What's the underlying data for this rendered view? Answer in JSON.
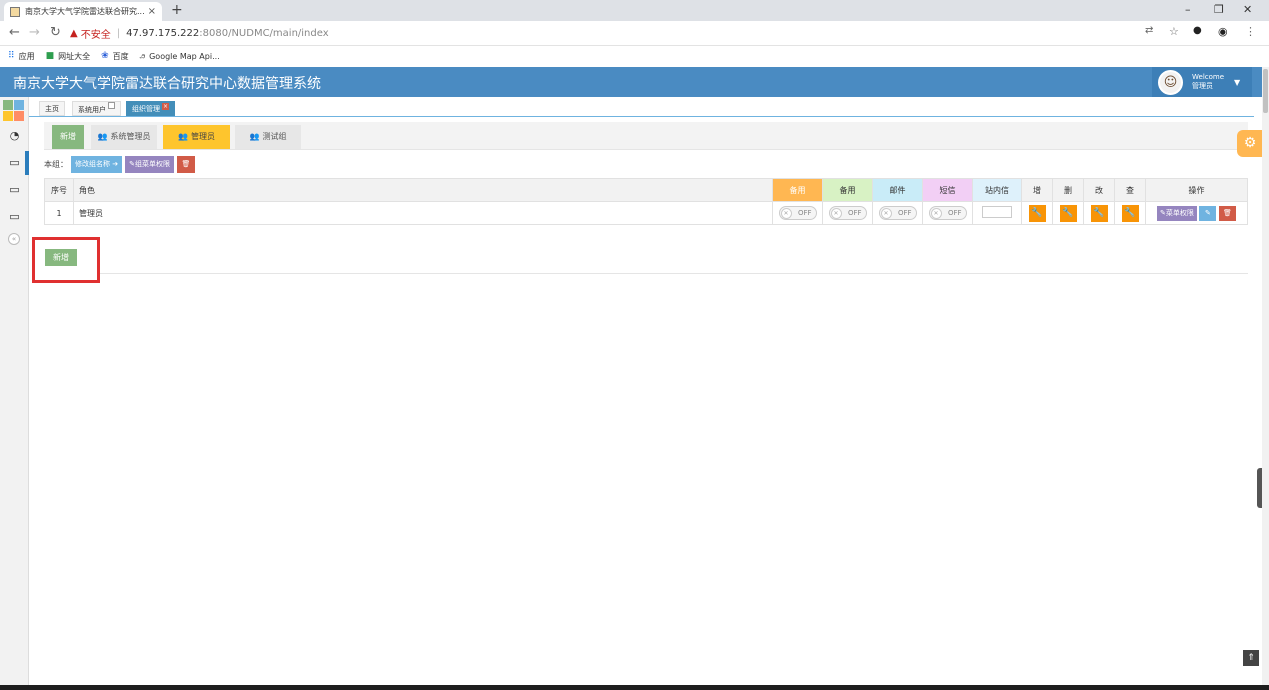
{
  "browser": {
    "tab_title": "南京大学大气学院雷达联合研究...",
    "tab_close": "×",
    "new_tab": "+",
    "window_controls": [
      "–",
      "❐",
      "✕"
    ],
    "insecure_label": "不安全",
    "url_host": "47.97.175.222",
    "url_path": ":8080/NUDMC/main/index",
    "bookmarks": [
      {
        "label": "应用",
        "icon": "apps-grid-icon"
      },
      {
        "label": "网址大全",
        "icon": "site-icon"
      },
      {
        "label": "百度",
        "icon": "baidu-icon"
      },
      {
        "label": "Google Map Api...",
        "icon": "map-icon"
      }
    ]
  },
  "header": {
    "title": "南京大学大气学院雷达联合研究中心数据管理系统",
    "welcome": "Welcome",
    "user": "管理员",
    "brand_color": "#4a8bc2"
  },
  "page_tabs": [
    {
      "label": "主页"
    },
    {
      "label": "系统用户"
    },
    {
      "label": "组织管理"
    }
  ],
  "groups": {
    "add_label": "新增",
    "items": [
      {
        "label": "系统管理员"
      },
      {
        "label": "管理员"
      },
      {
        "label": "测试组"
      }
    ],
    "selected": "管理员"
  },
  "group_actions": {
    "label": "本组：",
    "rename": "修改组名称",
    "menu_perm": "组菜单权限",
    "delete_icon": "trash-icon"
  },
  "table": {
    "headers": [
      "序号",
      "角色",
      "备用",
      "备用",
      "邮件",
      "短信",
      "站内信",
      "增",
      "删",
      "改",
      "查",
      "操作"
    ],
    "rows": [
      {
        "seq": "1",
        "role": "管理员",
        "switch_state": "OFF",
        "menu_perm": "菜单权限"
      }
    ]
  },
  "add_button": "新增",
  "colors": {
    "green": "#87b87f",
    "yellow": "#fec52d",
    "orange": "#f89406",
    "purple": "#9585bf",
    "red": "#d15b47",
    "highlight": "#e03030"
  }
}
